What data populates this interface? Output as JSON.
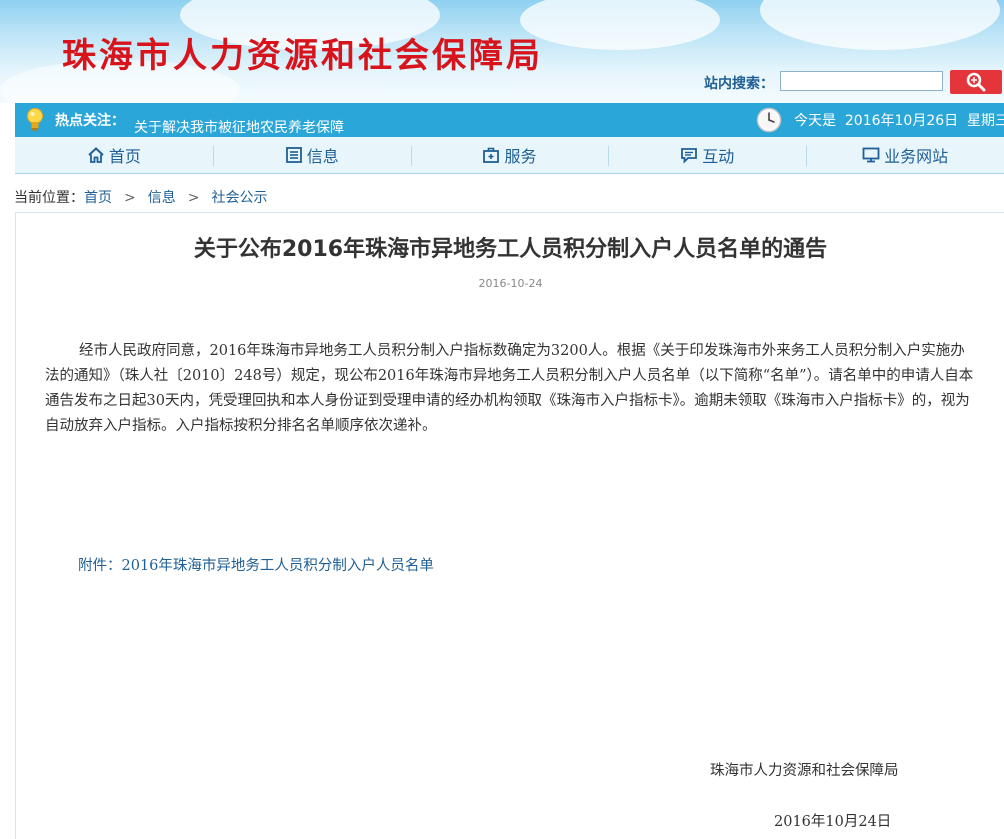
{
  "header": {
    "site_title": "珠海市人力资源和社会保障局",
    "search_label": "站内搜索：",
    "search_value": "",
    "search_button_icon": "search-icon"
  },
  "hotbar": {
    "label": "热点关注：",
    "news": "关于解决我市被征地农民养老保障",
    "date_text": "今天是  2016年10月26日  星期三"
  },
  "nav": {
    "items": [
      {
        "label": "首页",
        "icon": "home-icon"
      },
      {
        "label": "信息",
        "icon": "list-icon"
      },
      {
        "label": "服务",
        "icon": "briefcase-icon"
      },
      {
        "label": "互动",
        "icon": "chat-icon"
      },
      {
        "label": "业务网站",
        "icon": "monitor-icon"
      }
    ]
  },
  "breadcrumb": {
    "prefix": "当前位置：",
    "items": [
      "首页",
      "信息",
      "社会公示"
    ],
    "separator": ">"
  },
  "article": {
    "title": "关于公布2016年珠海市异地务工人员积分制入户人员名单的通告",
    "date": "2016-10-24",
    "body": "经市人民政府同意，2016年珠海市异地务工人员积分制入户指标数确定为3200人。根据《关于印发珠海市外来务工人员积分制入户实施办法的通知》（珠人社〔2010〕248号）规定，现公布2016年珠海市异地务工人员积分制入户人员名单（以下简称“名单”）。请名单中的申请人自本通告发布之日起30天内，凭受理回执和本人身份证到受理申请的经办机构领取《珠海市入户指标卡》。逾期未领取《珠海市入户指标卡》的，视为自动放弃入户指标。入户指标按积分排名名单顺序依次递补。",
    "attachment": "附件：2016年珠海市异地务工人员积分制入户人员名单",
    "signature": "珠海市人力资源和社会保障局",
    "sign_date": "2016年10月24日"
  },
  "colors": {
    "title_red": "#d7141c",
    "hotbar_blue": "#2ba6d9",
    "nav_text": "#1f5f95",
    "search_button": "#e4363a"
  }
}
